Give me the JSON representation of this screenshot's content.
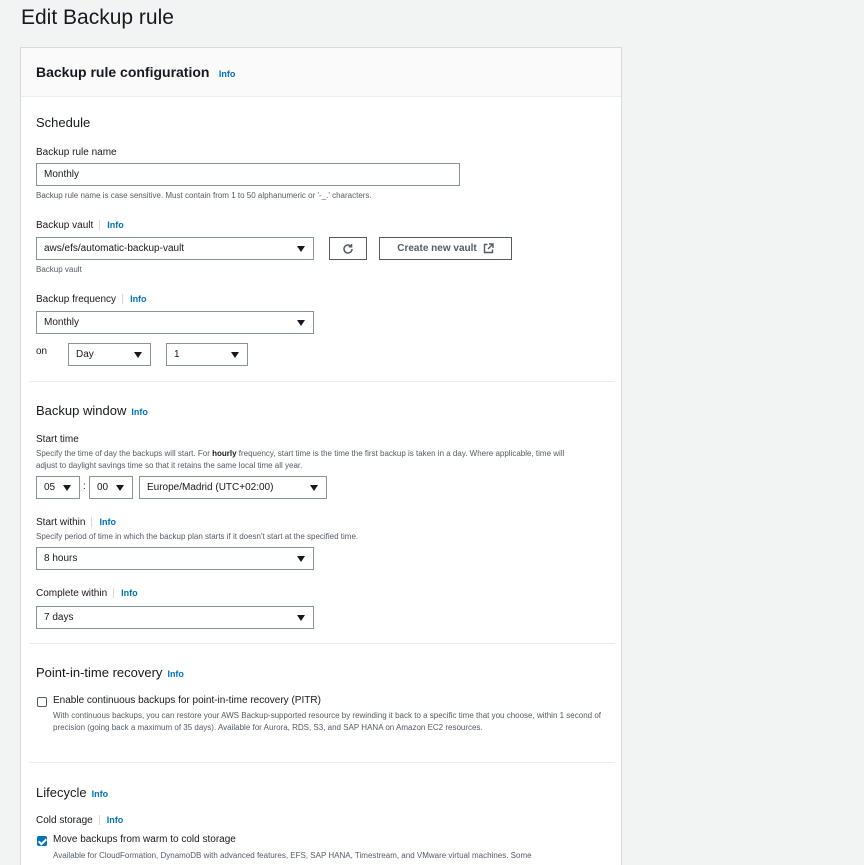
{
  "page": {
    "title": "Edit Backup rule"
  },
  "panel": {
    "title": "Backup rule configuration",
    "info": "Info"
  },
  "schedule": {
    "title": "Schedule",
    "rule_name_label": "Backup rule name",
    "rule_name_value": "Monthly",
    "rule_name_hint": "Backup rule name is case sensitive. Must contain from 1 to 50 alphanumeric or '-_.' characters.",
    "vault_label": "Backup vault",
    "vault_info": "Info",
    "vault_value": "aws/efs/automatic-backup-vault",
    "vault_hint": "Backup vault",
    "create_vault_label": "Create new vault",
    "frequency_label": "Backup frequency",
    "frequency_info": "Info",
    "frequency_value": "Monthly",
    "on_label": "on",
    "day_unit_value": "Day",
    "day_value": "1"
  },
  "window": {
    "title": "Backup window",
    "info": "Info",
    "start_time_label": "Start time",
    "start_time_desc_pre": "Specify the time of day the backups will start. For ",
    "start_time_desc_bold": "hourly",
    "start_time_desc_post": " frequency, start time is the time the first backup is taken in a day. Where applicable, time will adjust to daylight savings time so that it retains the same local time all year.",
    "hour_value": "05",
    "colon": ":",
    "minute_value": "00",
    "timezone_value": "Europe/Madrid (UTC+02:00)",
    "start_within_label": "Start within",
    "start_within_info": "Info",
    "start_within_desc": "Specify period of time in which the backup plan starts if it doesn't start at the specified time.",
    "start_within_value": "8 hours",
    "complete_within_label": "Complete within",
    "complete_within_info": "Info",
    "complete_within_value": "7 days"
  },
  "pitr": {
    "title": "Point-in-time recovery",
    "info": "Info",
    "checkbox_label": "Enable continuous backups for point-in-time recovery (PITR)",
    "checked": false,
    "desc": "With continuous backups, you can restore your AWS Backup-supported resource by rewinding it back to a specific time that you choose, within 1 second of precision (going back a maximum of 35 days). Available for Aurora, RDS, S3, and SAP HANA on Amazon EC2 resources."
  },
  "lifecycle": {
    "title": "Lifecycle",
    "info": "Info",
    "cold_storage_label": "Cold storage",
    "cold_storage_info": "Info",
    "checkbox_label": "Move backups from warm to cold storage",
    "checked": true,
    "desc": "Available for CloudFormation, DynamoDB with advanced features, EFS, SAP HANA, Timestream, and VMware virtual machines. Some"
  },
  "colors": {
    "accent": "#0073bb",
    "border": "#879596",
    "text": "#16191f",
    "muted": "#545b64"
  },
  "icons": {
    "dropdown": "caret-down-icon",
    "refresh": "refresh-icon",
    "external": "external-link-icon",
    "check": "checkmark-icon"
  }
}
